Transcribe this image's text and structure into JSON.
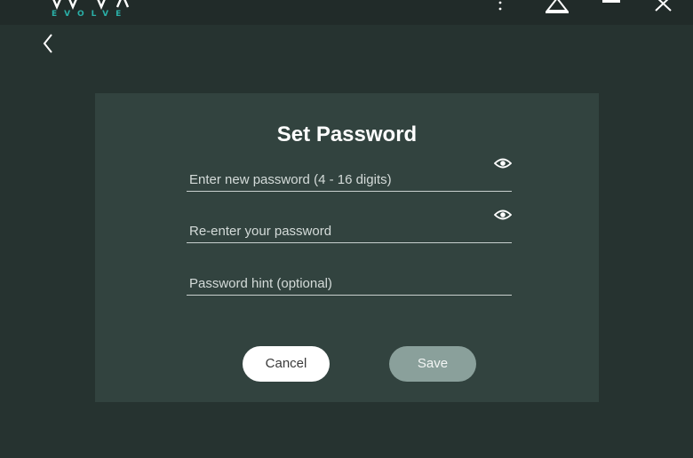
{
  "app": {
    "logo_sub": "EVOLVE"
  },
  "dialog": {
    "title": "Set Password",
    "fields": [
      {
        "placeholder": "Enter new password (4 - 16 digits)",
        "has_eye": true
      },
      {
        "placeholder": "Re-enter your password",
        "has_eye": true
      },
      {
        "placeholder": "Password hint (optional)",
        "has_eye": false
      }
    ],
    "cancel_label": "Cancel",
    "save_label": "Save"
  },
  "colors": {
    "background": "#263330",
    "card": "#32433f",
    "accent": "#2ab0a8",
    "save_disabled": "#8aa09b"
  },
  "icons": [
    "back-icon",
    "more-icon",
    "warning-icon",
    "minimize-icon",
    "close-icon",
    "eye-icon"
  ]
}
